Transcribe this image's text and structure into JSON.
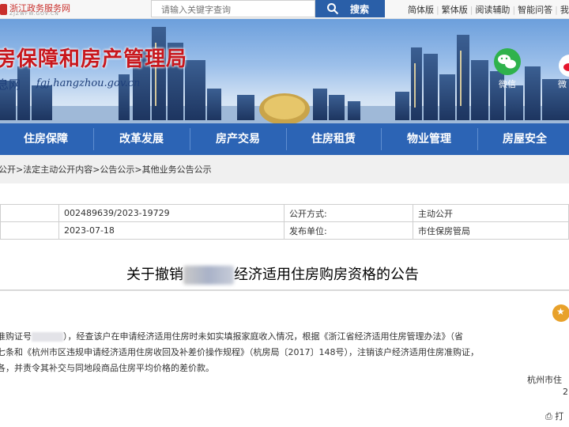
{
  "topbar": {
    "gov_name": "浙江政务服务网",
    "gov_domain": "ZJZWFW.GOV.CN",
    "search_placeholder": "请输入关键字查询",
    "search_button": "搜索",
    "links": [
      "简体版",
      "繁体版",
      "阅读辅助",
      "智能问答",
      "我"
    ]
  },
  "banner": {
    "title": "房保障和房产管理局",
    "sub": "息网",
    "url": "fgj.hangzhou.gov.cn",
    "wechat_label": "微信",
    "weibo_label": "微",
    "wechat_icon": "wechat-icon",
    "weibo_icon": "weibo-icon"
  },
  "nav": {
    "items": [
      "住房保障",
      "改革发展",
      "房产交易",
      "住房租赁",
      "物业管理",
      "房屋安全"
    ]
  },
  "breadcrumb": "公开>法定主动公开内容>公告公示>其他业务公告公示",
  "meta": {
    "rows": [
      {
        "value": "002489639/2023-19729",
        "label": "公开方式:",
        "value2": "主动公开"
      },
      {
        "value": "2023-07-18",
        "label": "发布单位:",
        "value2": "市住保房管局"
      }
    ]
  },
  "article": {
    "title_prefix": "关于撤销",
    "title_suffix": "经济适用住房购房资格的公告",
    "line1_a": "准购证号",
    "line1_b": "），经查该户在申请经济适用住房时未如实填报家庭收入情况，根据《浙江省经济适用住房管理办法》（省",
    "line2": "七条和《杭州市区违规申请经济适用住房收回及补差价操作规程》（杭房局〔2017〕148号），注销该户经济适用住房准购证，",
    "line3": "各，并责令其补交与同地段商品住房平均价格的差价款。",
    "signer": "杭州市住",
    "signer2": "2",
    "print": "⎙ 打"
  },
  "colors": {
    "nav": "#2c64b5",
    "title_red": "#c8171d",
    "search_btn": "#2a5fa8"
  }
}
